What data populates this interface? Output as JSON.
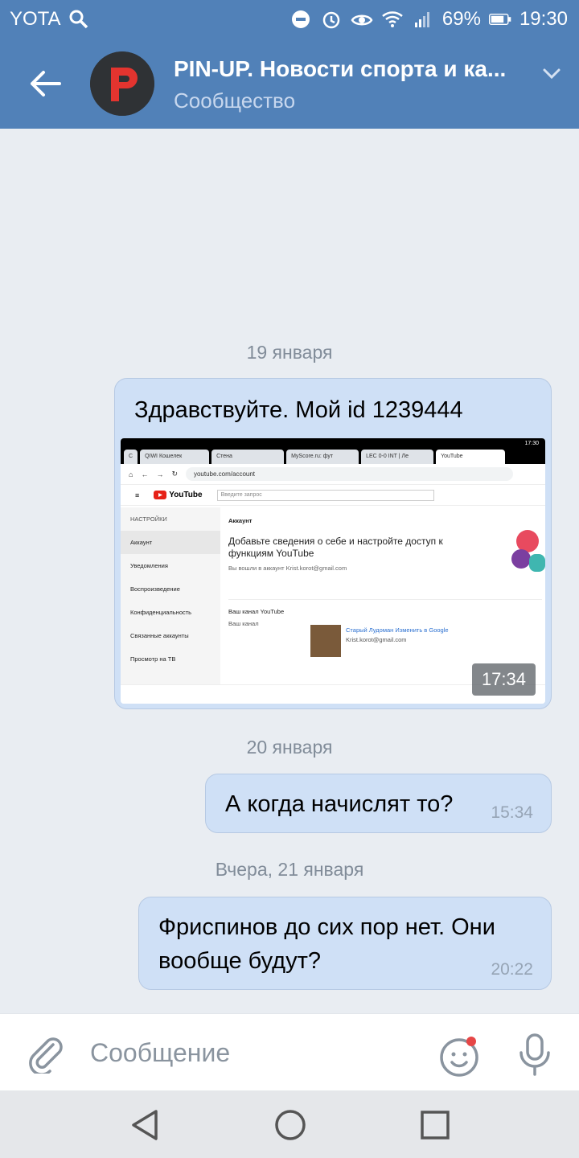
{
  "status": {
    "carrier": "YOTA",
    "battery": "69%",
    "time": "19:30"
  },
  "header": {
    "title": "PIN-UP. Новости спорта и ка...",
    "subtitle": "Сообщество"
  },
  "messages": {
    "date1": "19 января",
    "msg1": "Здравствуйте. Мой id 1239444",
    "msg1_time": "17:34",
    "date2": "20 января",
    "msg2": "А когда начислят то?",
    "msg2_time": "15:34",
    "date3": "Вчера, 21 января",
    "msg3": "Фриспинов до сих пор нет. Они вообще будут?",
    "msg3_time": "20:22"
  },
  "screenshot": {
    "status_time": "17:30",
    "tabs": [
      "С",
      "QIWI Кошелек",
      "Стена",
      "MyScore.ru: фут",
      "LEC 0-0 INT | Ле",
      "YouTube"
    ],
    "url": "youtube.com/account",
    "yt_logo": "YouTube",
    "search_placeholder": "Введите запрос",
    "side_title": "НАСТРОЙКИ",
    "side_items": [
      "Аккаунт",
      "Уведомления",
      "Воспроизведение",
      "Конфиденциальность",
      "Связанные аккаунты",
      "Просмотр на ТВ"
    ],
    "section": "Аккаунт",
    "headline": "Добавьте сведения о себе и настройте доступ к функциям YouTube",
    "signed_in": "Вы вошли в аккаунт Krist.korot@gmail.com",
    "channel_title": "Ваш канал YouTube",
    "channel_label": "Ваш канал",
    "channel_name": "Старый Лудоман",
    "channel_change": "Изменить в Google",
    "channel_email": "Krist.korot@gmail.com"
  },
  "input": {
    "placeholder": "Сообщение"
  },
  "colors": {
    "header": "#5181b8",
    "bubble": "#cfe0f6",
    "background": "#e9edf2"
  }
}
